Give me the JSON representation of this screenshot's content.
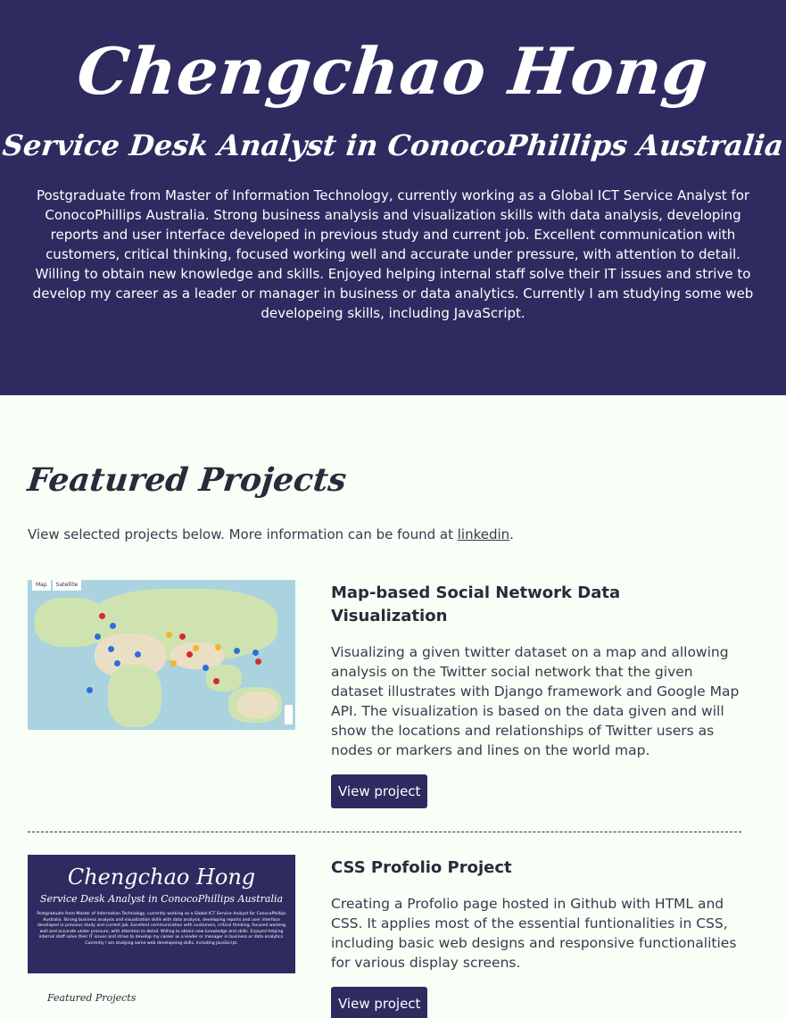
{
  "header": {
    "name": "Chengchao Hong",
    "role": "Service Desk Analyst in ConocoPhillips Australia",
    "about": "Postgraduate from Master of Information Technology, currently working as a Global ICT Service Analyst for ConocoPhillips Australia. Strong business analysis and visualization skills with data analysis, developing reports and user interface developed in previous study and current job. Excellent communication with customers, critical thinking, focused working well and accurate under pressure, with attention to detail. Willing to obtain new knowledge and skills. Enjoyed helping internal staff solve their IT issues and strive to develop my career as a leader or manager in business or data analytics. Currently I am studying some web developeing skills, including JavaScript."
  },
  "featured": {
    "title": "Featured Projects",
    "intro_prefix": "View selected projects below. More information can be found at ",
    "intro_link": "linkedin",
    "intro_suffix": "."
  },
  "projects": [
    {
      "title": "Map-based Social Network Data Visualization",
      "description": "Visualizing a given twitter dataset on a map and allowing analysis on the Twitter social network that the given dataset illustrates with Django framework and Google Map API. The visualization is based on the data given and will show the locations and relationships of Twitter users as nodes or markers and lines on the world map.",
      "button": "View project",
      "thumb_tabs": [
        "Map",
        "Satellite"
      ]
    },
    {
      "title": "CSS Profolio Project",
      "description": "Creating a Profolio page hosted in Github with HTML and CSS. It applies most of the essential funtionalities in CSS, including basic web designs and responsive functionalities for various display screens.",
      "button": "View project",
      "thumb_name": "Chengchao Hong",
      "thumb_role": "Service Desk Analyst in ConocoPhillips Australia",
      "thumb_featured": "Featured Projects"
    }
  ]
}
